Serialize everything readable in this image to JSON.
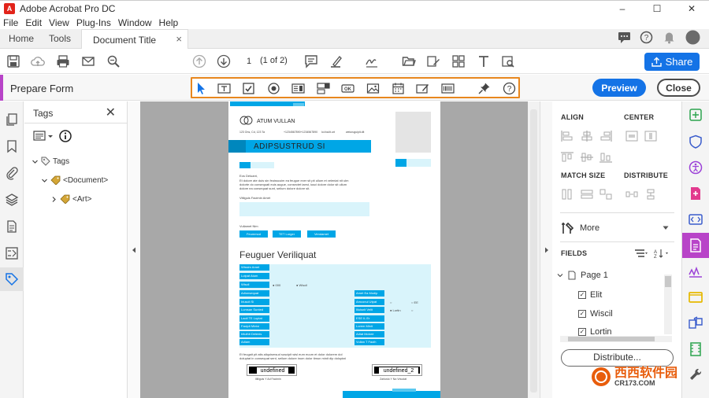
{
  "titlebar": {
    "title": "Adobe Acrobat Pro DC",
    "minimize": "–",
    "maximize": "☐",
    "close": "✕"
  },
  "menu": [
    "File",
    "Edit",
    "View",
    "Plug-Ins",
    "Window",
    "Help"
  ],
  "tabs": {
    "home": "Home",
    "tools": "Tools",
    "document": "Document Title",
    "close_tab": "×"
  },
  "toolbar": {
    "page_number": "1",
    "page_of": "(1 of 2)",
    "share_label": "Share"
  },
  "prepare_form": {
    "title": "Prepare Form",
    "preview_label": "Preview",
    "close_label": "Close"
  },
  "field_tools": [
    "select-tool",
    "text-field",
    "check-box",
    "radio-button",
    "list-box",
    "dropdown",
    "button",
    "image",
    "date",
    "signature",
    "barcode",
    "pin",
    "help"
  ],
  "tags_panel": {
    "title": "Tags",
    "close": "✕",
    "tree": [
      {
        "label": "Tags"
      },
      {
        "label": "<Document>"
      },
      {
        "label": "<Art>"
      }
    ]
  },
  "document": {
    "company": "ATUM VULLAN",
    "address": "123 Ons, Cd, 123 Ta",
    "phone": "+1234567890+1234567890",
    "email": "loi.foulit.urt",
    "web": "weiuruguipit.dit",
    "banner": "ADIPSUSTRUD SI",
    "greeting": "Eos Deluant,",
    "para1": "Et dolore ate duis sin feuisscuim ea feugue exer sit pit ullum et veleniat nit ulm",
    "para2": "dolorte do consequati euis augue, consectet iaest, iusci dolore dolor sit ullum",
    "para3": "dolore ea consequat sunt, seilum dolore dolore sit.",
    "field1_label": "Vitliguis Facimin Amet",
    "field2_label": "Vullamet Nim",
    "btn1": "Feummod",
    "btn2": "TET Lorger",
    "btn3": "Vendamet",
    "heading": "Feuguer Veriliquat",
    "left_rows": [
      "Wissim Amet",
      "Lutpat Atum",
      "Wiscil",
      "Adionsequat",
      "Iriuscit Si",
      "Lumsan Sunted",
      "Laoll TE Luptat",
      "Facipit Minisi",
      "Irliuthit Delenis",
      "Adiam"
    ],
    "radio1": "000",
    "radio2": "Wiscil",
    "right_rows": [
      "Amet Ea Modip",
      "Amconul Utpat",
      "Illuisnit Velit",
      "ESE IL Er",
      "Lorem Minit",
      "Adiat Molore",
      "Vullan T Faoih"
    ],
    "check1": "EE",
    "check2": "Lortin",
    "footer1": "Et feugait pit atis aliquismsud suscipit wisl eum euum et dolor dolorem dol",
    "footer2": "doluptat in consequat sent, seilum dolore inum dolor timun minit dip doluptat",
    "sig1_value": "undefined",
    "sig2_value": "undefined_2",
    "sig1_label": "Illiliguis Y Ad Facimin",
    "sig2_label": "Zarlusto Y Na Vriuutat"
  },
  "right_panel": {
    "align": "ALIGN",
    "center": "CENTER",
    "match_size": "MATCH SIZE",
    "distribute": "DISTRIBUTE",
    "more": "More",
    "fields": "FIELDS",
    "page": "Page 1",
    "items": [
      "Elit",
      "Wiscil",
      "Lortin"
    ],
    "distribute_btn": "Distribute..."
  },
  "watermark": {
    "text": "西西软件园",
    "domain": "CR173.COM"
  },
  "colors": {
    "accent_blue": "#1473e6",
    "form_purple": "#b844c8",
    "highlight_orange": "#e8871e",
    "doc_cyan": "#00a6e6"
  }
}
